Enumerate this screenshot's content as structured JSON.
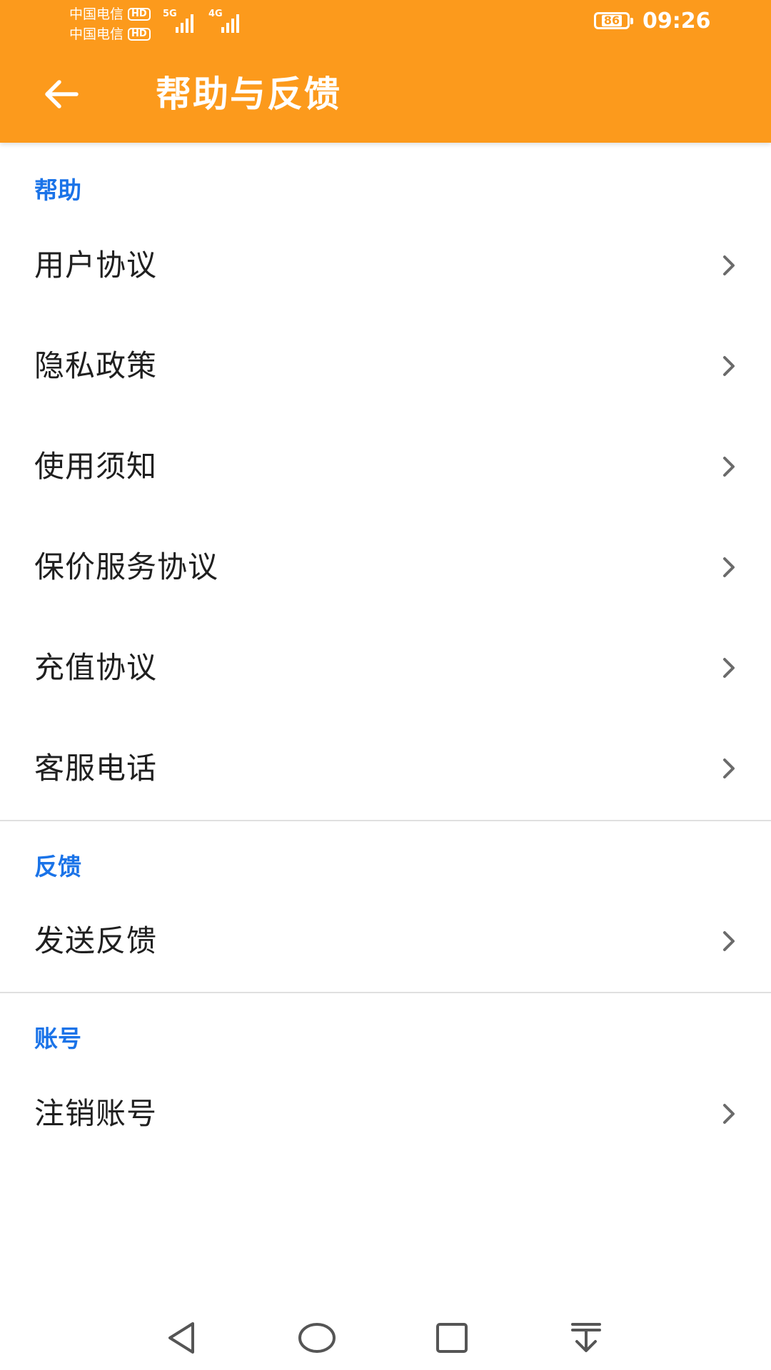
{
  "status_bar": {
    "carrier_1": "中国电信",
    "carrier_2": "中国电信",
    "hd_badge": "HD",
    "network_1": "5G",
    "network_2": "4G",
    "battery": "86",
    "time": "09:26"
  },
  "header": {
    "title": "帮助与反馈",
    "back_icon": "arrow-left-icon",
    "background": "#fc9a1c"
  },
  "sections": {
    "help": {
      "label": "帮助",
      "items": [
        "用户协议",
        "隐私政策",
        "使用须知",
        "保价服务协议",
        "充值协议",
        "客服电话"
      ]
    },
    "feedback": {
      "label": "反馈",
      "items": [
        "发送反馈"
      ]
    },
    "account": {
      "label": "账号",
      "items": [
        "注销账号"
      ]
    }
  },
  "colors": {
    "accent": "#fc9a1c",
    "section_label": "#1a73e8"
  },
  "nav_bar": {
    "icons": [
      "back-triangle-icon",
      "home-circle-icon",
      "recents-square-icon",
      "notification-pull-icon"
    ]
  }
}
